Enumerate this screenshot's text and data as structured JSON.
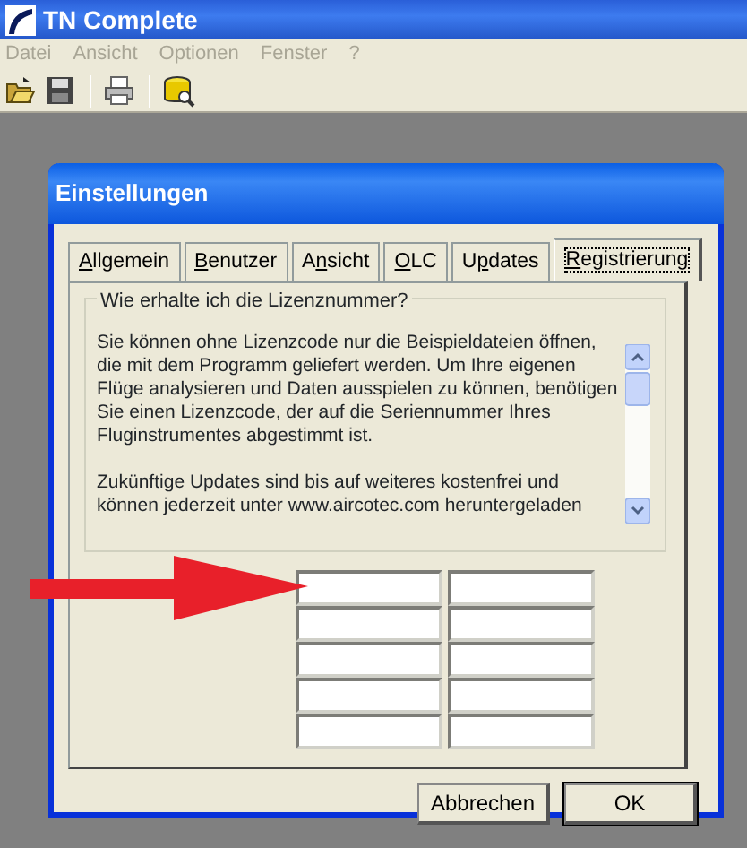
{
  "window": {
    "title": "TN Complete"
  },
  "menu": [
    {
      "label": "Datei",
      "disabled": true
    },
    {
      "label": "Ansicht",
      "disabled": true
    },
    {
      "label": "Optionen",
      "disabled": true
    },
    {
      "label": "Fenster",
      "disabled": true
    },
    {
      "label": "?",
      "disabled": true
    }
  ],
  "toolbar": [
    {
      "kind": "open"
    },
    {
      "kind": "save"
    },
    {
      "kind": "separator"
    },
    {
      "kind": "print"
    },
    {
      "kind": "separator"
    },
    {
      "kind": "database"
    }
  ],
  "dialog": {
    "title": "Einstellungen",
    "tabs": [
      {
        "key": "A",
        "after": "llgemein",
        "selected": false
      },
      {
        "key": "B",
        "after": "enutzer",
        "selected": false
      },
      {
        "before": "A",
        "key": "n",
        "after": "sicht",
        "selected": false
      },
      {
        "key": "O",
        "after": "LC",
        "selected": false
      },
      {
        "before": "U",
        "key": "p",
        "after": "dates",
        "selected": false
      },
      {
        "key": "R",
        "after": "egistrierung",
        "selected": true
      }
    ],
    "group": {
      "title": "Wie erhalte ich die Lizenznummer?",
      "paragraphs": [
        "Sie können ohne Lizenzcode nur die Beispieldateien öffnen, die mit dem Programm geliefert werden. Um Ihre eigenen Flüge analysieren und Daten ausspielen zu können, benötigen Sie einen Lizenzcode, der auf die Seriennummer Ihres Fluginstrumentes abgestimmt ist.",
        "Zukünftige Updates sind bis auf weiteres kostenfrei und können jederzeit unter www.aircotec.com heruntergeladen"
      ]
    },
    "code_fields": [
      [
        {
          "kind": "text"
        },
        {
          "kind": "text"
        }
      ],
      [
        {
          "kind": "text"
        },
        {
          "kind": "text"
        }
      ],
      [
        {
          "kind": "text"
        },
        {
          "kind": "text"
        }
      ],
      [
        {
          "kind": "text"
        },
        {
          "kind": "text"
        }
      ],
      [
        {
          "kind": "text"
        },
        {
          "kind": "text"
        }
      ]
    ],
    "buttons": [
      {
        "label": "Abbrechen",
        "default": false
      },
      {
        "label": "OK",
        "default": true
      }
    ]
  }
}
